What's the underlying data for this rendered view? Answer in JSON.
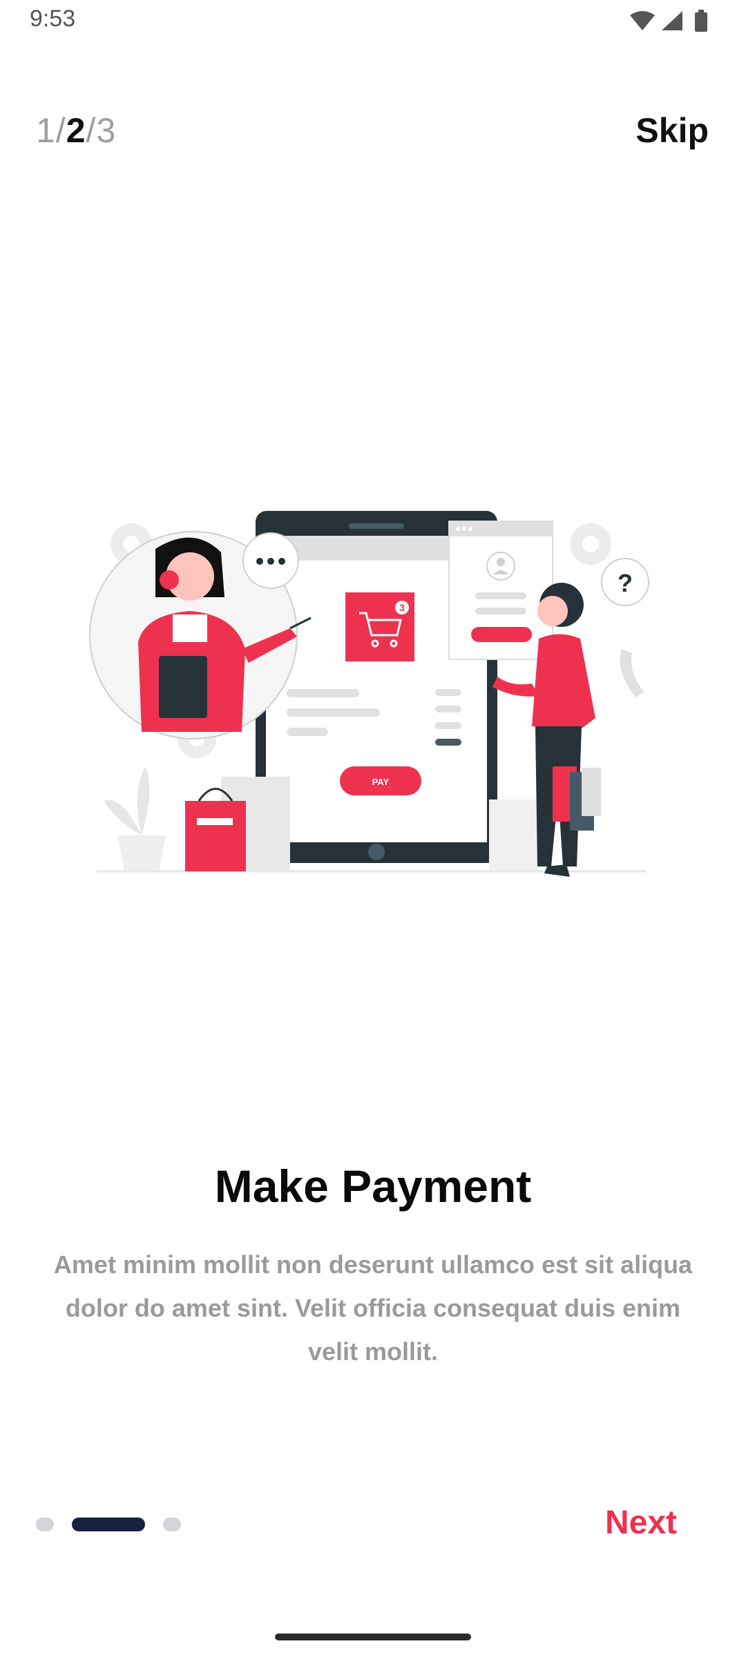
{
  "status_bar": {
    "time": "9:53",
    "icons": [
      "wifi-icon",
      "cellular-signal-icon",
      "battery-icon"
    ]
  },
  "header": {
    "step_first": "1",
    "step_current": "2",
    "step_last": "3",
    "separator": "/",
    "skip_label": "Skip"
  },
  "illustration": {
    "pay_label": "PAY",
    "cart_badge": "3",
    "question_mark": "?",
    "colors": {
      "accent": "#EF3150",
      "dark": "#263238",
      "light_gray": "#E0E0E0"
    }
  },
  "content": {
    "title": "Make Payment",
    "description": "Amet minim mollit non deserunt ullamco est sit aliqua dolor do amet sint. Velit officia consequat duis enim velit mollit."
  },
  "footer": {
    "pagination": {
      "total": 3,
      "active": 2
    },
    "next_label": "Next"
  },
  "theme": {
    "accent": "#EF3150",
    "indicator_active": "#18213D",
    "indicator_inactive": "#D4D4D8"
  }
}
